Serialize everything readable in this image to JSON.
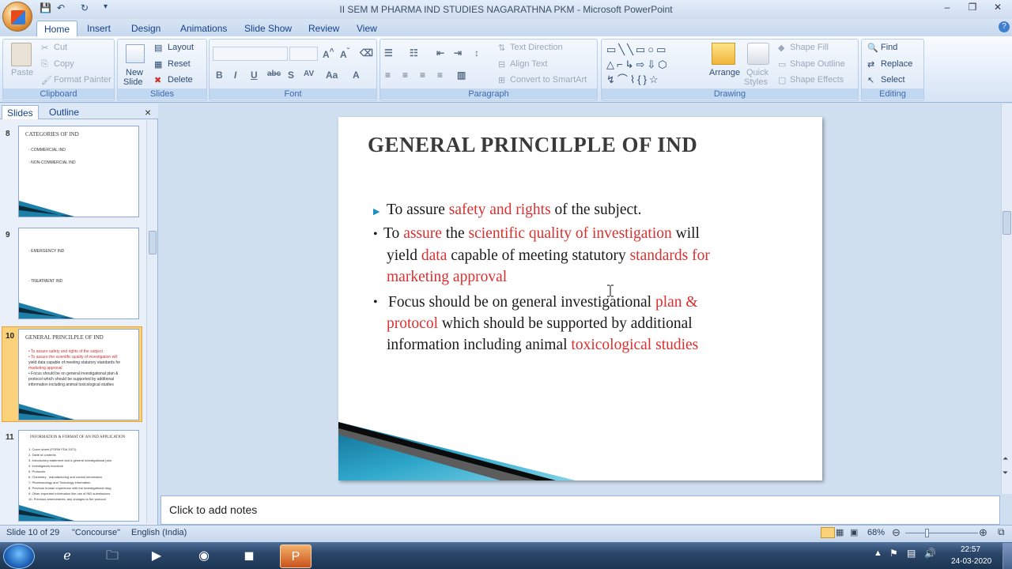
{
  "window": {
    "title": "II SEM M PHARMA IND STUDIES NAGARATHNA PKM - Microsoft PowerPoint",
    "controls": [
      "–",
      "❐",
      "✕"
    ]
  },
  "qat": {
    "save": "💾",
    "undo": "↶",
    "redo": "↻",
    "customize": "▾"
  },
  "tabs": [
    "Home",
    "Insert",
    "Design",
    "Animations",
    "Slide Show",
    "Review",
    "View"
  ],
  "ribbon": {
    "clipboard": {
      "label": "Clipboard",
      "paste": "Paste",
      "cut": "Cut",
      "copy": "Copy",
      "format_painter": "Format Painter"
    },
    "slides": {
      "label": "Slides",
      "new_slide_1": "New",
      "new_slide_2": "Slide",
      "layout": "Layout",
      "reset": "Reset",
      "delete": "Delete"
    },
    "font": {
      "label": "Font",
      "bold": "B",
      "italic": "I",
      "underline": "U",
      "strike": "abc",
      "shadow": "S",
      "spacing": "AV",
      "case": "Aa",
      "color": "A"
    },
    "paragraph": {
      "label": "Paragraph",
      "text_direction": "Text Direction",
      "align_text": "Align Text",
      "convert": "Convert to SmartArt"
    },
    "drawing": {
      "label": "Drawing",
      "arrange": "Arrange",
      "quick_styles_1": "Quick",
      "quick_styles_2": "Styles",
      "shape_fill": "Shape Fill",
      "shape_outline": "Shape Outline",
      "shape_effects": "Shape Effects"
    },
    "editing": {
      "label": "Editing",
      "find": "Find",
      "replace": "Replace",
      "select": "Select"
    }
  },
  "pane": {
    "tab_slides": "Slides",
    "tab_outline": "Outline",
    "close": "×"
  },
  "thumbs": [
    {
      "num": "8",
      "title": "CATEGORIES OF IND",
      "lines": [
        "◦ COMMERCIAL IND",
        "◦ NON-COMMERCIAL IND"
      ]
    },
    {
      "num": "9",
      "title": "",
      "lines": [
        "◦ EMERGENCY IND",
        "◦ TREATMENT IND"
      ]
    },
    {
      "num": "10",
      "title": "GENERAL PRINCILPLE  OF IND",
      "lines": [
        "• To assure safety and rights of the subject.",
        "• To assure the scientific quality of investigation will",
        "  yield data capable of meeting statutory standards for",
        "  marketing approval",
        "• Focus should be on general investigational plan &",
        "  protocol which should be supported by additional",
        "  information including animal toxicological studies"
      ]
    },
    {
      "num": "11",
      "title": "INFORMATION & FORMAT OF AN IND APPLICATION",
      "lines": [
        "1. Cover sheet (FORM FDA 1571)",
        "2. Table of contents",
        "3. Introductory statement and a general investigational plan",
        "4. Investigators brochure",
        "5. Protocols",
        "6. Chemistry , manufacturing and control information",
        "7. Pharmacology and Toxicology information",
        "8. Previous human experience with the investigational drug",
        "9. Other important information like use of IND submissions",
        "10. Previous amendments, any changes to the protocol"
      ]
    }
  ],
  "slide": {
    "title": "GENERAL PRINCILPLE  OF IND",
    "b1": {
      "t1": "To assure ",
      "r1": "safety and rights",
      "t2": " of the subject."
    },
    "b2": {
      "t1": "To ",
      "r1": "assure",
      "t2": " the ",
      "r2": "scientific quality of investigation",
      "t3": " will",
      "t4": "yield ",
      "r3": "data",
      "t5": " capable of meeting statutory ",
      "r4": "standards for",
      "r5": "marketing approval"
    },
    "b3": {
      "t1": "Focus should be on general investigational ",
      "r1": "plan &",
      "r2": "protocol",
      "t2": " which should be supported by additional",
      "t3": "information including animal ",
      "r3": "toxicological studies"
    }
  },
  "notes": "Click to add notes",
  "status": {
    "slide": "Slide 10 of 29",
    "theme": "\"Concourse\"",
    "language": "English (India)",
    "zoom": "68%"
  },
  "taskbar": {
    "time": "22:57",
    "date": "24-03-2020"
  },
  "colors": {
    "accent_red": "#d93030",
    "selection": "#fbd27a",
    "ribbon": "#dde8f6"
  }
}
